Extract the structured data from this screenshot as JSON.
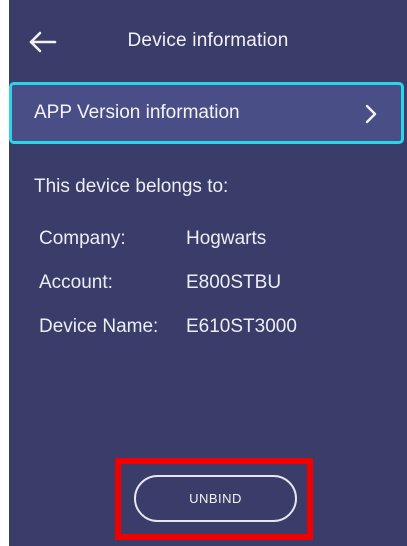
{
  "header": {
    "title": "Device information",
    "back_icon": "arrow-left-icon"
  },
  "app_version": {
    "label": "APP Version information",
    "chevron_icon": "chevron-right-icon"
  },
  "ownership": {
    "heading": "This device belongs to:",
    "company_label": "Company:",
    "company_value": "Hogwarts",
    "account_label": "Account:",
    "account_value": "E800STBU",
    "device_name_label": "Device Name:",
    "device_name_value": "E610ST3000"
  },
  "actions": {
    "unbind_label": "UNBIND"
  },
  "colors": {
    "background": "#3a3d69",
    "accent_border": "#2ad5e8",
    "highlight_box": "#f20000"
  }
}
